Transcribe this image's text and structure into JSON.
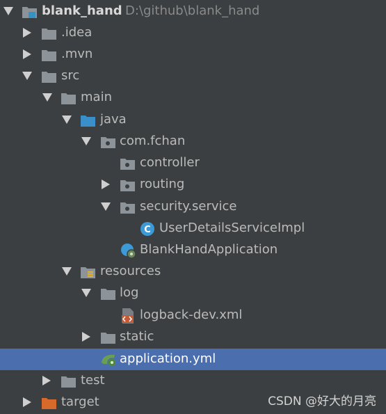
{
  "project_tree": {
    "root": {
      "label": "blank_hand",
      "path": "D:\\github\\blank_hand",
      "icon": "project-folder-icon"
    },
    "idea": {
      "label": ".idea",
      "icon": "folder-icon"
    },
    "mvn": {
      "label": ".mvn",
      "icon": "folder-icon"
    },
    "src": {
      "label": "src",
      "icon": "folder-icon"
    },
    "main": {
      "label": "main",
      "icon": "folder-icon"
    },
    "java": {
      "label": "java",
      "icon": "source-folder-icon",
      "color": "#3a8fc8"
    },
    "package": {
      "label": "com.fchan",
      "icon": "package-icon"
    },
    "controller": {
      "label": "controller",
      "icon": "package-icon"
    },
    "routing": {
      "label": "routing",
      "icon": "package-icon"
    },
    "security_service": {
      "label": "security.service",
      "icon": "package-icon"
    },
    "user_details_impl": {
      "label": "UserDetailsServiceImpl",
      "icon": "java-class-icon",
      "color": "#3d9ad6"
    },
    "app_class": {
      "label": "BlankHandApplication",
      "icon": "spring-boot-class-icon"
    },
    "resources": {
      "label": "resources",
      "icon": "resources-folder-icon"
    },
    "log": {
      "label": "log",
      "icon": "folder-icon"
    },
    "logback": {
      "label": "logback-dev.xml",
      "icon": "xml-file-icon",
      "color": "#c35b36"
    },
    "static": {
      "label": "static",
      "icon": "folder-icon"
    },
    "application_yml": {
      "label": "application.yml",
      "icon": "spring-yml-icon",
      "selected": true,
      "selection_color": "#4b6eaf"
    },
    "test": {
      "label": "test",
      "icon": "folder-icon"
    },
    "target": {
      "label": "target",
      "icon": "excluded-folder-icon",
      "color": "#d7692a"
    }
  },
  "watermark": "CSDN @好大的月亮"
}
